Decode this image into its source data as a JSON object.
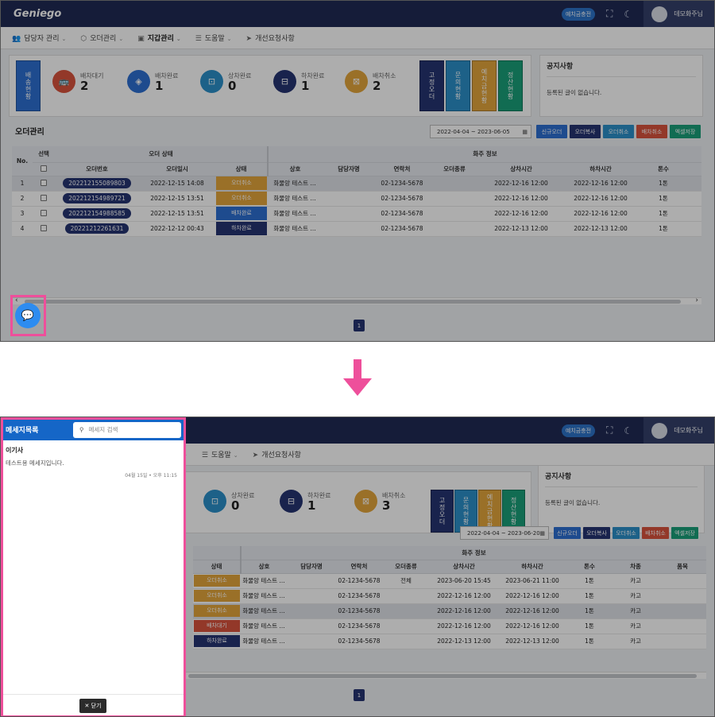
{
  "top": {
    "logo": "Geniego",
    "charge_badge": "예치금충전",
    "fullscreen_icon": "⛶",
    "darkmode_icon": "☾",
    "user_name": "데모화주님"
  },
  "menu": [
    {
      "icon": "👥",
      "label": "담당자 관리"
    },
    {
      "icon": "⬡",
      "label": "오더관리"
    },
    {
      "icon": "▣",
      "label": "지갑관리"
    },
    {
      "icon": "☰",
      "label": "도움말"
    },
    {
      "icon": "➤",
      "label": "개선요청사항"
    }
  ],
  "side_button": "배송현황",
  "stats": [
    {
      "label": "배차대기",
      "value": "2",
      "icon": "🚌",
      "color": "#d9533d"
    },
    {
      "label": "배차완료",
      "value": "1",
      "icon": "◈",
      "color": "#2d6fd1"
    },
    {
      "label": "상차완료",
      "value": "0",
      "icon": "⊡",
      "color": "#2b8fc9"
    },
    {
      "label": "하차완료",
      "value": "1",
      "icon": "⊟",
      "color": "#263472"
    },
    {
      "label": "배차취소",
      "value": "2",
      "icon": "⊠",
      "color": "#e4a53b"
    }
  ],
  "stats_after": [
    {
      "label": "상차완료",
      "value": "0",
      "icon": "⊡",
      "color": "#2b8fc9"
    },
    {
      "label": "하차완료",
      "value": "1",
      "icon": "⊟",
      "color": "#263472"
    },
    {
      "label": "배차취소",
      "value": "3",
      "icon": "⊠",
      "color": "#e4a53b"
    }
  ],
  "vbuttons": [
    {
      "label": "고정오더",
      "color": "#263472"
    },
    {
      "label": "문의현황",
      "color": "#2b8fc9"
    },
    {
      "label": "예치금현황",
      "color": "#e4a53b"
    },
    {
      "label": "정산현황",
      "color": "#1aa07a"
    }
  ],
  "notice": {
    "title": "공지사항",
    "empty": "등록된 글이 없습니다."
  },
  "orders_title": "오더관리",
  "date_range": "2022-04-04 ~ 2023-06-05",
  "date_range_after": "2022-04-04 ~ 2023-06-20",
  "calendar_icon": "▦",
  "actions": [
    {
      "label": "신규오더",
      "color": "#2d6fd1"
    },
    {
      "label": "오더복사",
      "color": "#263472"
    },
    {
      "label": "오더취소",
      "color": "#2b8fc9"
    },
    {
      "label": "배차취소",
      "color": "#d9533d"
    },
    {
      "label": "엑셀저장",
      "color": "#1aa07a"
    }
  ],
  "table": {
    "group_order_status": "오더 상태",
    "group_shipper": "화주 정보",
    "col_no": "No.",
    "col_select": "선택",
    "col_order_no": "오더번호",
    "col_order_date": "오더일시",
    "col_status": "상태",
    "col_company": "상호",
    "col_manager": "담당자명",
    "col_contact": "연락처",
    "col_order_type": "오더종류",
    "col_load_time": "상차시간",
    "col_unload_time": "하차시간",
    "col_tonnage": "톤수",
    "col_vehicle": "차종",
    "col_item": "품목",
    "rows": [
      {
        "no": "1",
        "order_no": "202212155089803",
        "date": "2022-12-15 14:08",
        "status": "오더취소",
        "status_color": "#e4a53b",
        "company": "화물앙 테스트 ...",
        "contact": "02-1234-5678",
        "load": "2022-12-16 12:00",
        "unload": "2022-12-16 12:00",
        "ton": "1톤"
      },
      {
        "no": "2",
        "order_no": "202212154989721",
        "date": "2022-12-15 13:51",
        "status": "오더취소",
        "status_color": "#e4a53b",
        "company": "화물앙 테스트 ...",
        "contact": "02-1234-5678",
        "load": "2022-12-16 12:00",
        "unload": "2022-12-16 12:00",
        "ton": "1톤"
      },
      {
        "no": "3",
        "order_no": "202212154988585",
        "date": "2022-12-15 13:51",
        "status": "배차완료",
        "status_color": "#2d6fd1",
        "company": "화물앙 테스트 ...",
        "contact": "02-1234-5678",
        "load": "2022-12-16 12:00",
        "unload": "2022-12-16 12:00",
        "ton": "1톤"
      },
      {
        "no": "4",
        "order_no": "20221212261631",
        "date": "2022-12-12 00:43",
        "status": "하차완료",
        "status_color": "#263472",
        "company": "화물앙 테스트 ...",
        "contact": "02-1234-5678",
        "load": "2022-12-13 12:00",
        "unload": "2022-12-13 12:00",
        "ton": "1톤"
      }
    ],
    "rows_after": [
      {
        "status": "오더취소",
        "status_color": "#e4a53b",
        "company": "화물앙 테스트 ...",
        "contact": "02-1234-5678",
        "type": "전체",
        "load": "2023-06-20 15:45",
        "unload": "2023-06-21 11:00",
        "ton": "1톤",
        "vehicle": "카고"
      },
      {
        "status": "오더취소",
        "status_color": "#e4a53b",
        "company": "화물앙 테스트 ...",
        "contact": "02-1234-5678",
        "type": "",
        "load": "2022-12-16 12:00",
        "unload": "2022-12-16 12:00",
        "ton": "1톤",
        "vehicle": "카고"
      },
      {
        "status": "오더취소",
        "status_color": "#e4a53b",
        "company": "화물앙 테스트 ...",
        "contact": "02-1234-5678",
        "type": "",
        "load": "2022-12-16 12:00",
        "unload": "2022-12-16 12:00",
        "ton": "1톤",
        "vehicle": "카고"
      },
      {
        "status": "배차대기",
        "status_color": "#d9533d",
        "company": "화물앙 테스트 ...",
        "contact": "02-1234-5678",
        "type": "",
        "load": "2022-12-16 12:00",
        "unload": "2022-12-16 12:00",
        "ton": "1톤",
        "vehicle": "카고"
      },
      {
        "status": "하차완료",
        "status_color": "#263472",
        "company": "화물앙 테스트 ...",
        "contact": "02-1234-5678",
        "type": "",
        "load": "2022-12-13 12:00",
        "unload": "2022-12-13 12:00",
        "ton": "1톤",
        "vehicle": "카고"
      }
    ]
  },
  "page_number": "1",
  "chat_icon": "💬",
  "scroll_left": "‹",
  "scroll_right": "›",
  "messages_panel": {
    "title": "메세지목록",
    "search_placeholder": "메세지 검색",
    "search_icon": "⚲",
    "messages": [
      {
        "from": "이기사",
        "text": "테스트용 메세지입니다.",
        "time": "04월 15일 • 오후 11:15"
      }
    ],
    "close_label": "✕  닫기"
  },
  "highlight_color": "#ee4f9b"
}
